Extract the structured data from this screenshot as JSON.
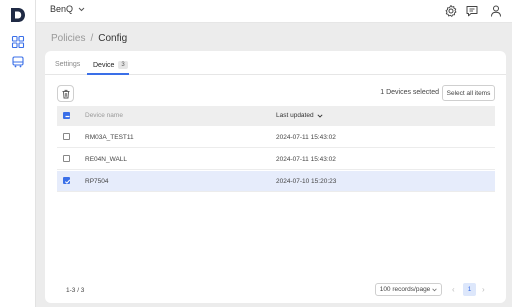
{
  "app": {
    "workspace": "BenQ"
  },
  "breadcrumb": {
    "parent": "Policies",
    "separator": "/",
    "current": "Config"
  },
  "tabs": [
    {
      "label": "Settings",
      "active": false
    },
    {
      "label": "Device",
      "badge": "3",
      "active": true
    }
  ],
  "toolbar": {
    "selected_text": "1 Devices selected",
    "select_all_label": "Select all items"
  },
  "table": {
    "columns": [
      "Device name",
      "Last updated"
    ],
    "rows": [
      {
        "name": "RM03A_TEST11",
        "updated": "2024-07-11 15:43:02",
        "checked": false
      },
      {
        "name": "RE04N_WALL",
        "updated": "2024-07-11 15:43:02",
        "checked": false
      },
      {
        "name": "RP7504",
        "updated": "2024-07-10 15:20:23",
        "checked": true
      }
    ]
  },
  "footer": {
    "range": "1-3 / 3",
    "page_size": "100 records/page",
    "current_page": "1"
  },
  "colors": {
    "accent": "#3a6fe8",
    "selected_row": "#e6ecfb",
    "header_bg": "#eeeeee"
  }
}
